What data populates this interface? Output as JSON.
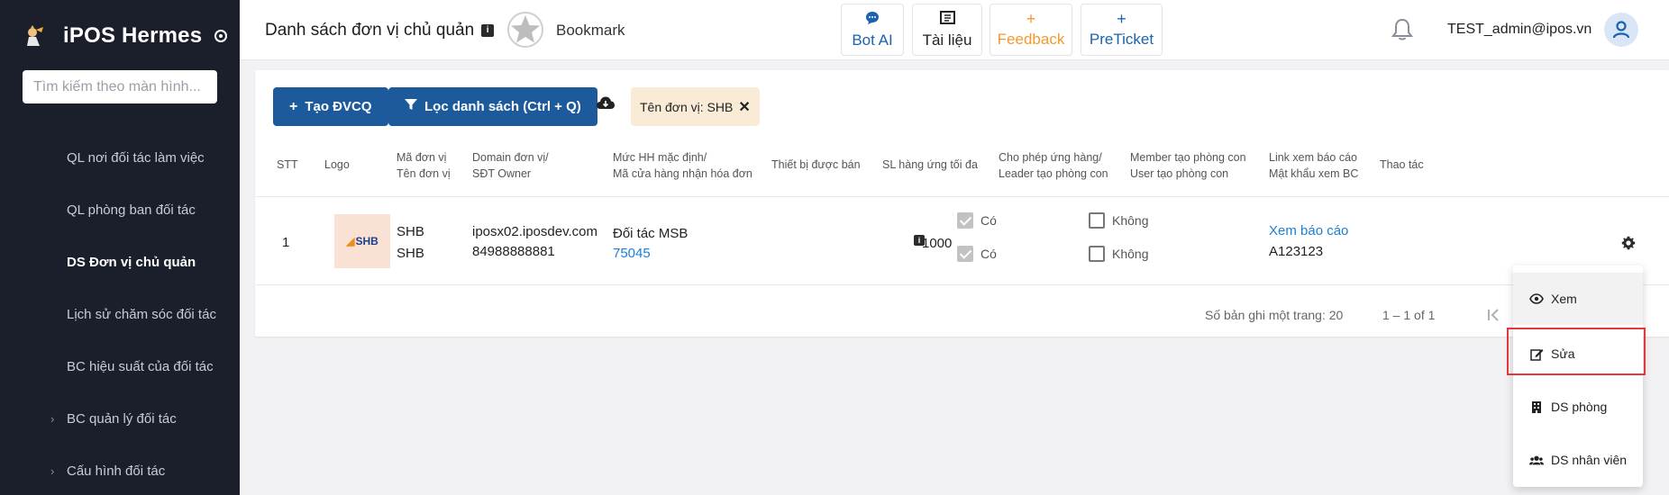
{
  "sidebar": {
    "app_name": "iPOS Hermes",
    "search_placeholder": "Tìm kiếm theo màn hình...",
    "items": [
      {
        "label": "QL nơi đối tác làm việc",
        "active": false,
        "expandable": false
      },
      {
        "label": "QL phòng ban đối tác",
        "active": false,
        "expandable": false
      },
      {
        "label": "DS Đơn vị chủ quản",
        "active": true,
        "expandable": false
      },
      {
        "label": "Lịch sử chăm sóc đối tác",
        "active": false,
        "expandable": false
      },
      {
        "label": "BC hiệu suất của đối tác",
        "active": false,
        "expandable": false
      },
      {
        "label": "BC quản lý đối tác",
        "active": false,
        "expandable": true
      },
      {
        "label": "Cấu hình đối tác",
        "active": false,
        "expandable": true
      }
    ]
  },
  "header": {
    "title": "Danh sách đơn vị chủ quản",
    "bookmark_label": "Bookmark",
    "buttons": [
      {
        "label": "Bot AI",
        "icon": "chat-icon",
        "color": "#1b63b0"
      },
      {
        "label": "Tài liệu",
        "icon": "book-icon",
        "color": "#222222"
      },
      {
        "label": "Feedback",
        "icon": "plus-icon",
        "color": "#f3982e"
      },
      {
        "label": "PreTicket",
        "icon": "plus-icon",
        "color": "#1b63b0"
      }
    ],
    "user_email": "TEST_admin@ipos.vn"
  },
  "toolbar": {
    "create_label": "Tạo ĐVCQ",
    "filter_label": "Lọc danh sách (Ctrl + Q)",
    "filter_chip": "Tên đơn vị: SHB"
  },
  "table": {
    "headers": {
      "stt": "STT",
      "logo": "Logo",
      "code_line1": "Mã đơn vị",
      "code_line2": "Tên đơn vị",
      "domain_line1": "Domain đơn vị/",
      "domain_line2": "SĐT Owner",
      "hh_line1": "Mức HH mặc định/",
      "hh_line2": "Mã cửa hàng nhận hóa đơn",
      "device": "Thiết bị được bán",
      "max_qty": "SL hàng ứng tối đa",
      "allow_line1": "Cho phép ứng hàng/",
      "allow_line2": "Leader tạo phòng con",
      "member_line1": "Member tạo phòng con",
      "member_line2": "User tạo phòng con",
      "report_line1": "Link xem báo cáo",
      "report_line2": "Mật khẩu xem BC",
      "actions": "Thao tác"
    },
    "rows": [
      {
        "stt": "1",
        "logo_text": "SHB",
        "code": "SHB",
        "name": "SHB",
        "domain": "iposx02.iposdev.com",
        "phone": "84988888881",
        "hh_level": "Đối tác MSB",
        "store_code": "75045",
        "max_qty": "1000",
        "allow_advance": "Có",
        "leader_create_room": "Có",
        "member_create_room": "Không",
        "user_create_room": "Không",
        "report_link": "Xem báo cáo",
        "report_password": "A123123"
      }
    ]
  },
  "pagination": {
    "page_size_label": "Số bản ghi một trang: 20",
    "range_label": "1 – 1 of 1"
  },
  "context_menu": {
    "items": [
      {
        "label": "Xem",
        "icon": "eye-icon"
      },
      {
        "label": "Sửa",
        "icon": "edit-icon"
      },
      {
        "label": "DS phòng",
        "icon": "building-icon"
      },
      {
        "label": "DS nhân viên",
        "icon": "users-icon"
      }
    ],
    "highlighted": "Sửa"
  }
}
